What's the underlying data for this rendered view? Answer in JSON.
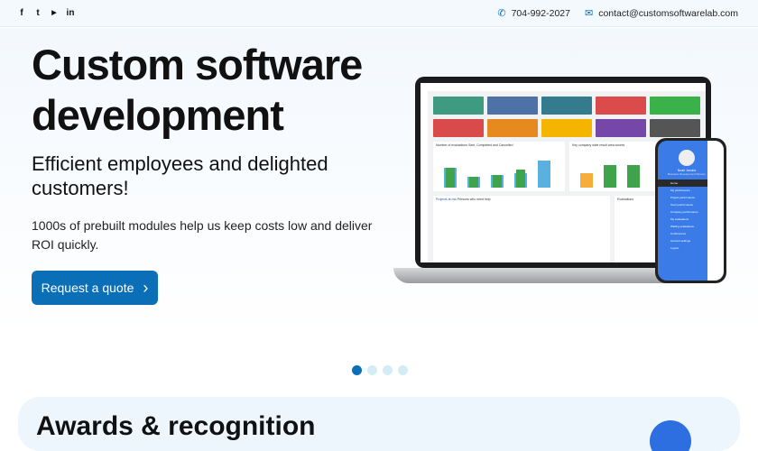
{
  "topbar": {
    "social": [
      {
        "icon": "facebook-icon",
        "glyph": "f"
      },
      {
        "icon": "twitter-icon",
        "glyph": "t"
      },
      {
        "icon": "youtube-icon",
        "glyph": "▶"
      },
      {
        "icon": "linkedin-icon",
        "glyph": "in"
      }
    ],
    "phone": "704-992-2027",
    "email": "contact@customsoftwarelab.com"
  },
  "hero": {
    "title": "Custom software development",
    "subtitle": "Efficient employees and delighted customers!",
    "description": "1000s of prebuilt modules help us keep costs low and deliver ROI quickly.",
    "cta": "Request a quote",
    "cta_arrow": "›"
  },
  "mockup": {
    "chart1_title": "Number of evaluations Sent, Completed and Cancelled",
    "chart2_title": "Key company wide result area scores",
    "tab1": "Projects at risk",
    "tab2": "Persons who need help",
    "evaluations_title": "Evaluations",
    "phone_user": "Noah Jacobs",
    "phone_role": "Business Development Director",
    "phone_menu": [
      "Home",
      "My performance",
      "Project performance",
      "Team performance",
      "Company performance",
      "My evaluations",
      "Waiting evaluations",
      "Conferences",
      "Account settings",
      "Logout"
    ]
  },
  "carousel": {
    "total": 4,
    "active": 0
  },
  "awards": {
    "title": "Awards & recognition"
  },
  "colors": {
    "accent": "#0b6fb8"
  }
}
